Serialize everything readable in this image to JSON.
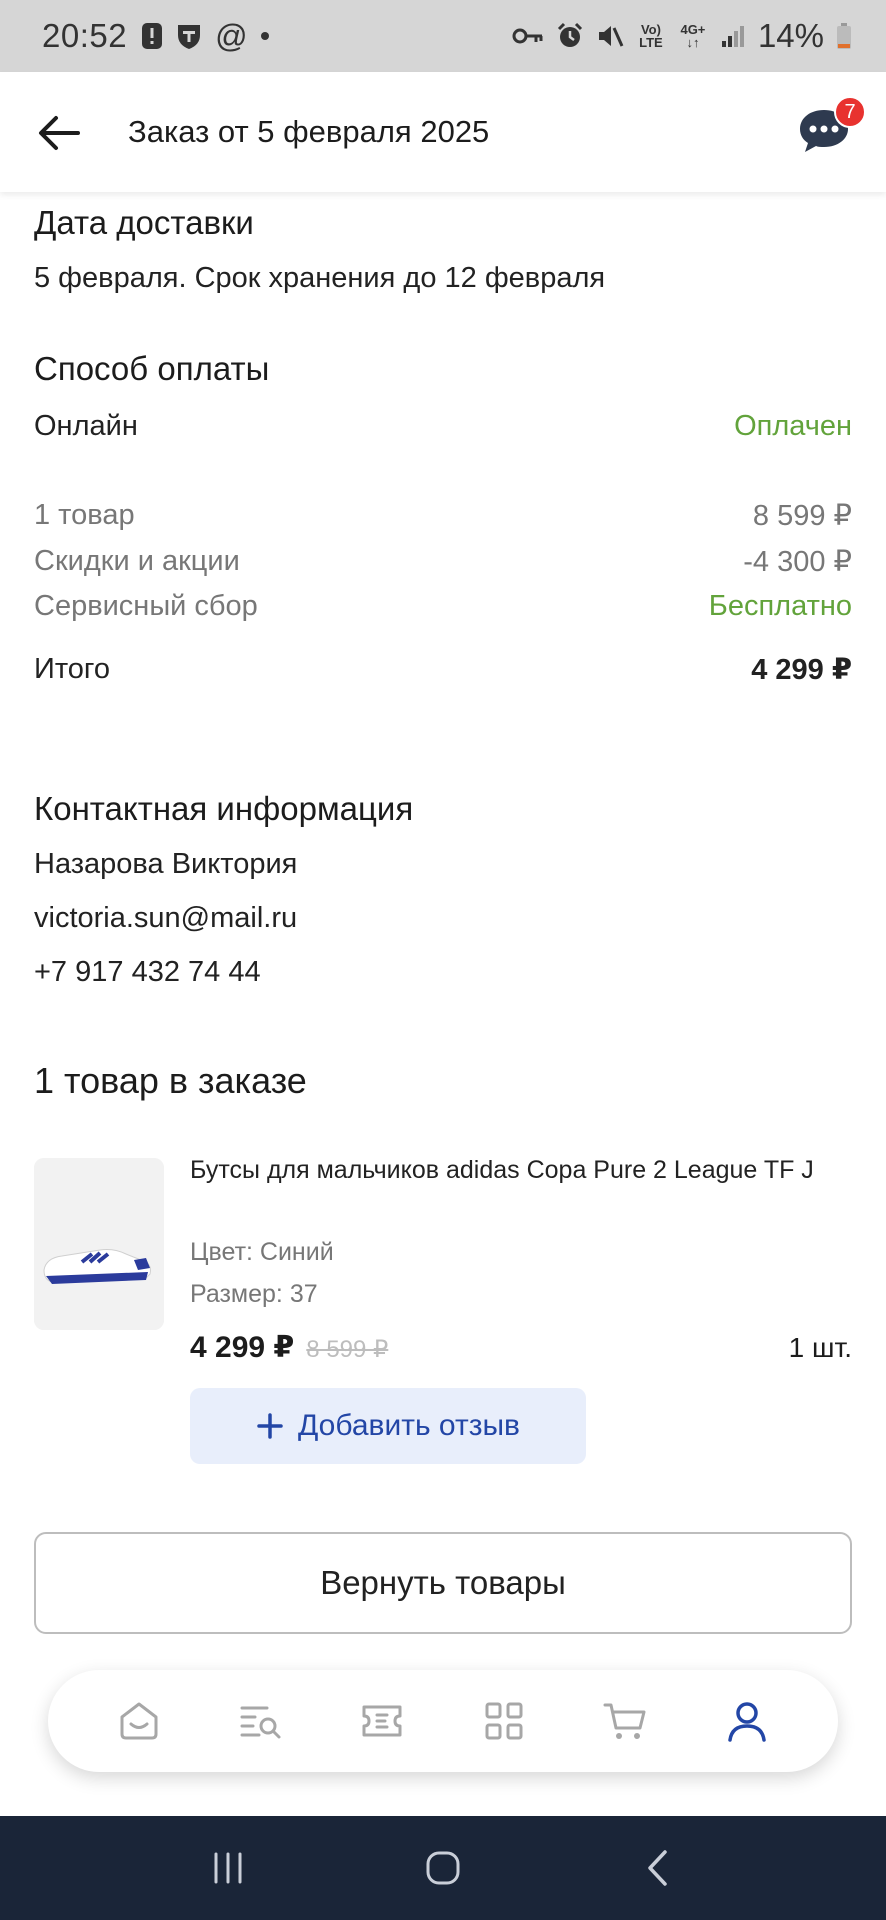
{
  "status_bar": {
    "time": "20:52",
    "battery": "14%",
    "volte": "Vo) LTE",
    "network": "4G+",
    "icons": [
      "alert-icon",
      "shield-icon",
      "at-icon",
      "dot-icon",
      "key-icon",
      "alarm-icon",
      "mute-icon",
      "volte-icon",
      "network-arrows-icon",
      "signal-icon",
      "battery-icon"
    ]
  },
  "header": {
    "title": "Заказ от 5 февраля 2025",
    "chat_badge": "7"
  },
  "delivery": {
    "title": "Дата доставки",
    "text": "5 февраля. Срок хранения до 12 февраля"
  },
  "payment": {
    "title": "Способ оплаты",
    "method": "Онлайн",
    "status": "Оплачен"
  },
  "summary": {
    "items_label": "1 товар",
    "items_value": "8 599 ₽",
    "discount_label": "Скидки и акции",
    "discount_value": "-4 300 ₽",
    "fee_label": "Сервисный сбор",
    "fee_value": "Бесплатно",
    "total_label": "Итого",
    "total_value": "4 299 ₽"
  },
  "contact": {
    "title": "Контактная информация",
    "name": "Назарова Виктория",
    "email": "victoria.sun@mail.ru",
    "phone": "+7 917 432 74 44"
  },
  "order_items": {
    "title": "1 товар в заказе",
    "product": {
      "name": "Бутсы для мальчиков adidas Copa Pure 2 League TF J",
      "color": "Цвет: Синий",
      "size": "Размер: 37",
      "price": "4 299 ₽",
      "old_price": "8 599 ₽",
      "quantity": "1 шт."
    },
    "review_button": "Добавить отзыв",
    "return_button": "Вернуть товары"
  },
  "bottom_nav": {
    "items": [
      "home-icon",
      "catalog-search-icon",
      "coupon-icon",
      "grid-icon",
      "cart-icon",
      "profile-icon"
    ],
    "active": "profile-icon",
    "active_color": "#2346a6"
  },
  "colors": {
    "accent_green": "#62a33b",
    "accent_blue": "#2346a6",
    "badge_red": "#e8322f"
  }
}
